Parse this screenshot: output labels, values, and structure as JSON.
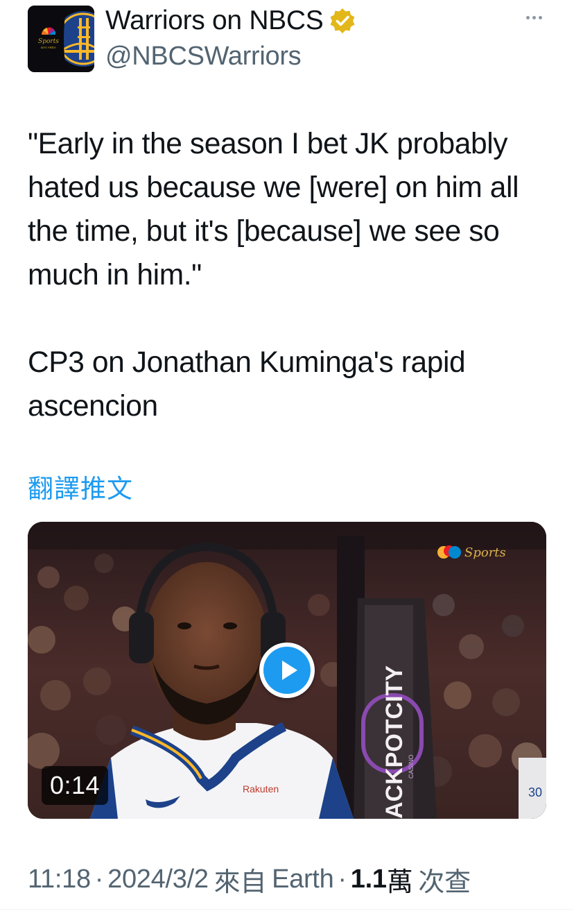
{
  "tweet": {
    "author": {
      "display_name": "Warriors on NBCS",
      "handle": "@NBCSWarriors",
      "verified": true,
      "avatar_icon": "nbc-sports-bay-area-warriors-logo",
      "avatar_text": {
        "line1": "Sports",
        "line2": "BAY AREA"
      }
    },
    "more_icon": "more-dots-icon",
    "text": {
      "quote": "\"Early in the season I bet JK probably hated us because we [were] on him all the time, but it's [because] we see so much in him.\"",
      "caption": "CP3 on Jonathan Kuminga's rapid ascencion"
    },
    "translate_label": "翻譯推文",
    "media": {
      "type": "video",
      "duration": "0:14",
      "play_icon": "play-icon",
      "overlay_texts": {
        "network_logo": "Sports",
        "banner": "ACKPOTCITY",
        "banner_sub": "CASINO",
        "jersey_sponsor": "Rakuten",
        "jersey_number": "30"
      }
    },
    "meta": {
      "time": "11:18",
      "date": "2024/3/2",
      "source_prefix": "來自",
      "source": "Earth",
      "views_count": "1.1",
      "views_unit": "萬",
      "views_label": "次查"
    }
  },
  "colors": {
    "text_primary": "#0f1419",
    "text_secondary": "#536471",
    "link": "#1d9bf0",
    "verified_badge": "#e2b719"
  }
}
